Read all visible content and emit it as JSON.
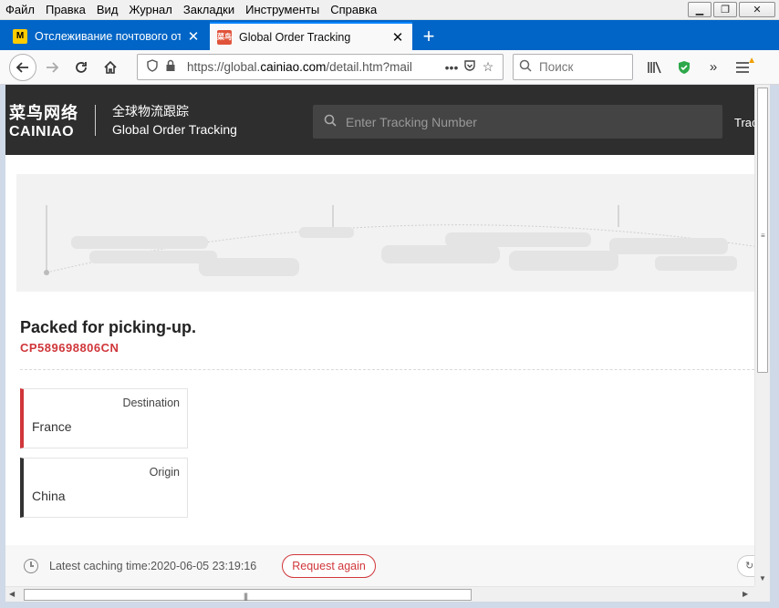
{
  "menubar": {
    "items": [
      "Файл",
      "Правка",
      "Вид",
      "Журнал",
      "Закладки",
      "Инструменты",
      "Справка"
    ]
  },
  "tabs": [
    {
      "title": "Отслеживание почтового отп",
      "favicon": "M",
      "active": false
    },
    {
      "title": "Global Order Tracking",
      "favicon": "菜鸟",
      "active": true
    }
  ],
  "navbar": {
    "url_prefix": "https://global.",
    "url_domain": "cainiao.com",
    "url_suffix": "/detail.htm?mail",
    "search_placeholder": "Поиск"
  },
  "header": {
    "logo_cn": "菜鸟网络",
    "logo_en": "CAINIAO",
    "title_cn": "全球物流跟踪",
    "title_en": "Global Order Tracking",
    "search_placeholder": "Enter Tracking Number",
    "right_link": "Trac"
  },
  "shipment": {
    "status": "Packed for picking-up.",
    "tracking_number": "CP589698806CN",
    "destination_label": "Destination",
    "destination_value": "France",
    "origin_label": "Origin",
    "origin_value": "China"
  },
  "footer": {
    "cache_text": "Latest caching time:2020-06-05 23:19:16",
    "request_button": "Request again"
  },
  "colors": {
    "accent_red": "#d0363a",
    "header_dark": "#2e2e2e",
    "tab_blue": "#0a84ff"
  }
}
